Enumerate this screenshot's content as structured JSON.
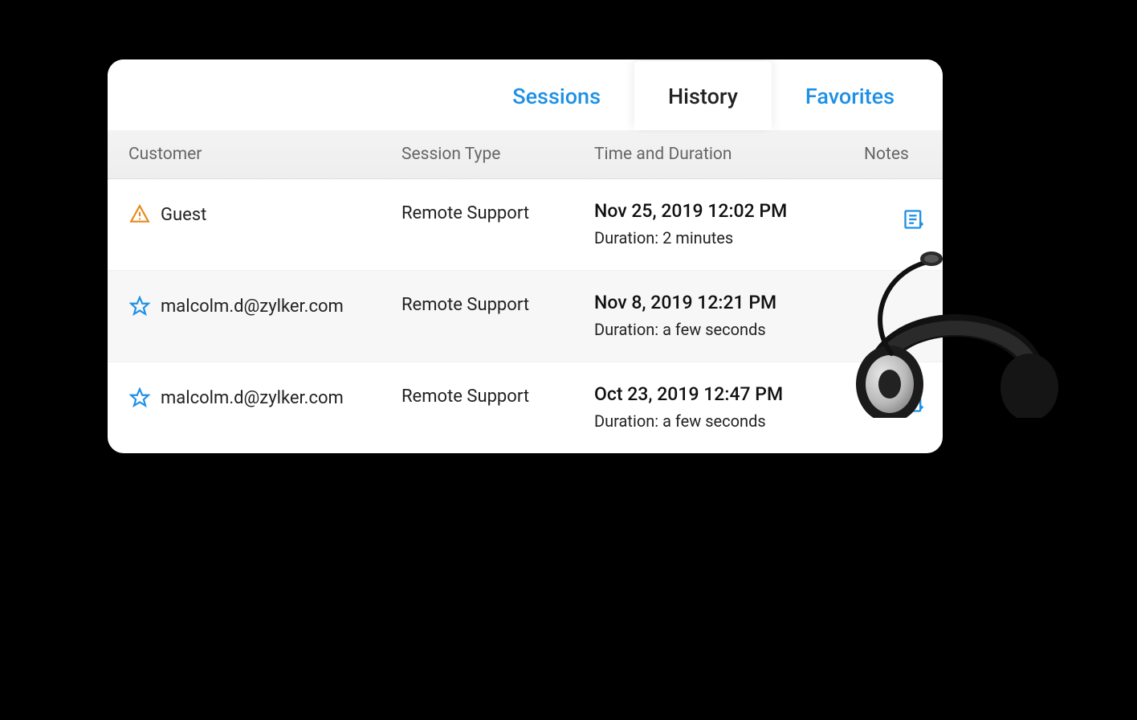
{
  "tabs": {
    "sessions": "Sessions",
    "history": "History",
    "favorites": "Favorites",
    "active": "history"
  },
  "columns": {
    "customer": "Customer",
    "session_type": "Session Type",
    "time": "Time and Duration",
    "notes": "Notes"
  },
  "rows": [
    {
      "icon": "warning",
      "customer": "Guest",
      "session_type": "Remote Support",
      "timestamp": "Nov 25, 2019 12:02 PM",
      "duration": "Duration: 2 minutes",
      "has_note_action": true
    },
    {
      "icon": "star",
      "customer": "malcolm.d@zylker.com",
      "session_type": "Remote Support",
      "timestamp": "Nov 8, 2019 12:21 PM",
      "duration": "Duration: a few seconds",
      "has_note_action": false
    },
    {
      "icon": "star",
      "customer": "malcolm.d@zylker.com",
      "session_type": "Remote Support",
      "timestamp": "Oct 23, 2019 12:47 PM",
      "duration": "Duration: a few seconds",
      "has_note_action": true
    }
  ],
  "colors": {
    "accent": "#1e90e6",
    "warning": "#e68a1e"
  }
}
